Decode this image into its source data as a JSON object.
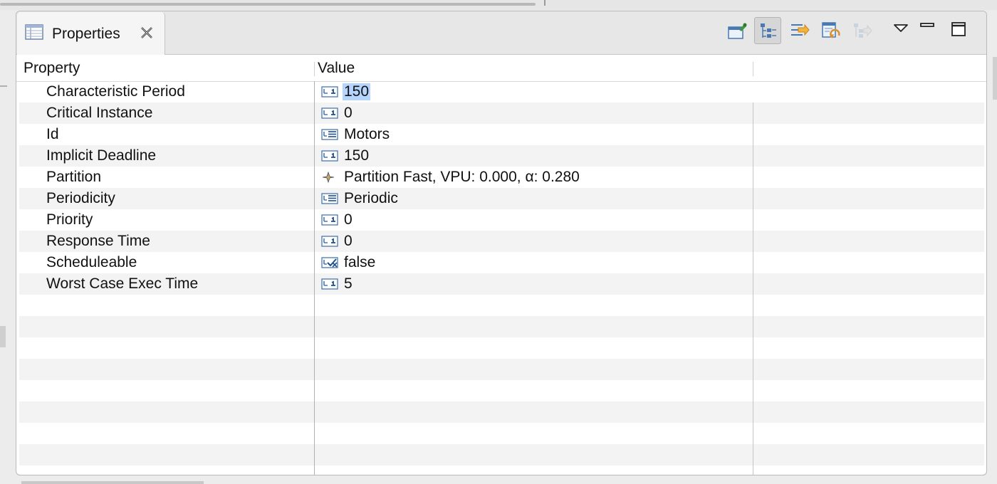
{
  "view": {
    "tab_title": "Properties",
    "tab_icon": "properties-table-icon",
    "close_icon": "close-x-icon"
  },
  "toolbar": [
    {
      "name": "pin-to-selection-button",
      "icon": "pin-icon"
    },
    {
      "name": "show-categories-button",
      "icon": "tree-categories-icon",
      "pressed": true
    },
    {
      "name": "show-advanced-button",
      "icon": "filter-advanced-icon"
    },
    {
      "name": "restore-default-button",
      "icon": "restore-default-icon"
    },
    {
      "name": "disabled-action-button",
      "icon": "disabled-tree-icon",
      "disabled": true
    },
    {
      "name": "view-menu-button",
      "icon": "triangle-down-icon"
    },
    {
      "name": "minimize-button",
      "icon": "minimize-icon"
    },
    {
      "name": "maximize-button",
      "icon": "maximize-icon"
    }
  ],
  "columns": {
    "property": "Property",
    "value": "Value"
  },
  "rows": [
    {
      "property": "Characteristic Period",
      "value": "150",
      "icon": "integer-icon",
      "selected": true
    },
    {
      "property": "Critical Instance",
      "value": "0",
      "icon": "integer-icon"
    },
    {
      "property": "Id",
      "value": "Motors",
      "icon": "text-icon"
    },
    {
      "property": "Implicit Deadline",
      "value": "150",
      "icon": "integer-icon"
    },
    {
      "property": "Partition",
      "value": "Partition Fast, VPU: 0.000, α: 0.280",
      "icon": "reference-icon"
    },
    {
      "property": "Periodicity",
      "value": "Periodic",
      "icon": "text-icon"
    },
    {
      "property": "Priority",
      "value": "0",
      "icon": "integer-icon"
    },
    {
      "property": "Response Time",
      "value": "0",
      "icon": "integer-icon"
    },
    {
      "property": "Scheduleable",
      "value": "false",
      "icon": "boolean-icon"
    },
    {
      "property": "Worst Case Exec Time",
      "value": "5",
      "icon": "integer-icon"
    }
  ],
  "colors": {
    "selection": "#b5d5ff",
    "row_alt": "#f3f3f3",
    "icon_blue": "#3a6ea5",
    "icon_orange": "#d9932b",
    "icon_green": "#3c9a3c"
  }
}
